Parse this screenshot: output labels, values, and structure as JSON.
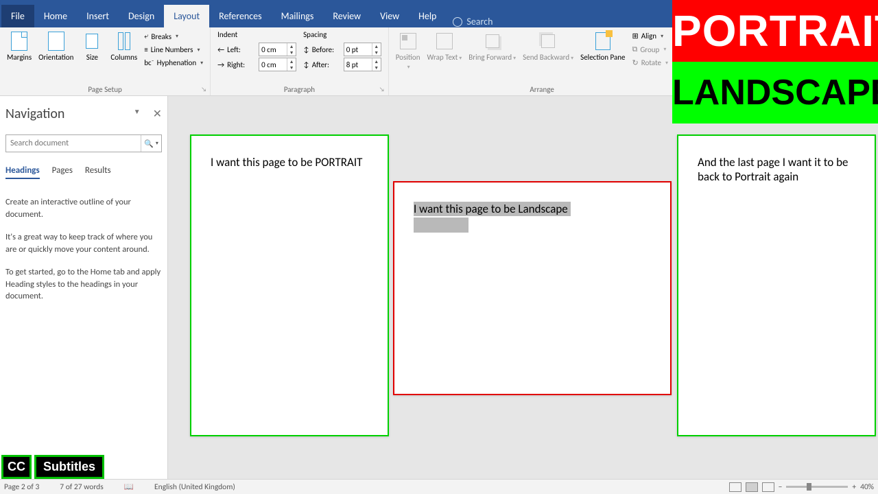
{
  "tabs": {
    "file": "File",
    "home": "Home",
    "insert": "Insert",
    "design": "Design",
    "layout": "Layout",
    "references": "References",
    "mailings": "Mailings",
    "review": "Review",
    "view": "View",
    "help": "Help",
    "tellme": "Search"
  },
  "ribbon": {
    "pagesetup": {
      "label": "Page Setup",
      "margins": "Margins",
      "orientation": "Orientation",
      "size": "Size",
      "columns": "Columns",
      "breaks": "Breaks",
      "linenumbers": "Line Numbers",
      "hyphenation": "Hyphenation"
    },
    "paragraph": {
      "label": "Paragraph",
      "indent_title": "Indent",
      "spacing_title": "Spacing",
      "left_label": "Left:",
      "right_label": "Right:",
      "before_label": "Before:",
      "after_label": "After:",
      "left": "0 cm",
      "right": "0 cm",
      "before": "0 pt",
      "after": "8 pt"
    },
    "arrange": {
      "label": "Arrange",
      "position": "Position",
      "wrap": "Wrap Text",
      "bring": "Bring Forward",
      "send": "Send Backward",
      "selpane": "Selection Pane",
      "align": "Align",
      "group": "Group",
      "rotate": "Rotate"
    }
  },
  "nav": {
    "title": "Navigation",
    "search_placeholder": "Search document",
    "tabs": {
      "headings": "Headings",
      "pages": "Pages",
      "results": "Results"
    },
    "help1": "Create an interactive outline of your document.",
    "help2": "It's a great way to keep track of where you are or quickly move your content around.",
    "help3": "To get started, go to the Home tab and apply Heading styles to the headings in your document."
  },
  "pages": {
    "p1": "I want this page to be PORTRAIT",
    "p2": "I want this page to be Landscape",
    "p3": "And the last page I want it to be back to Portrait again"
  },
  "status": {
    "page": "Page 2 of 3",
    "words": "7 of 27 words",
    "lang": "English (United Kingdom)",
    "zoom": "40%"
  },
  "cc": {
    "cc": "CC",
    "sub": "Subtitles"
  },
  "banner": {
    "p": "PORTRAIT",
    "l": "LANDSCAPE"
  }
}
